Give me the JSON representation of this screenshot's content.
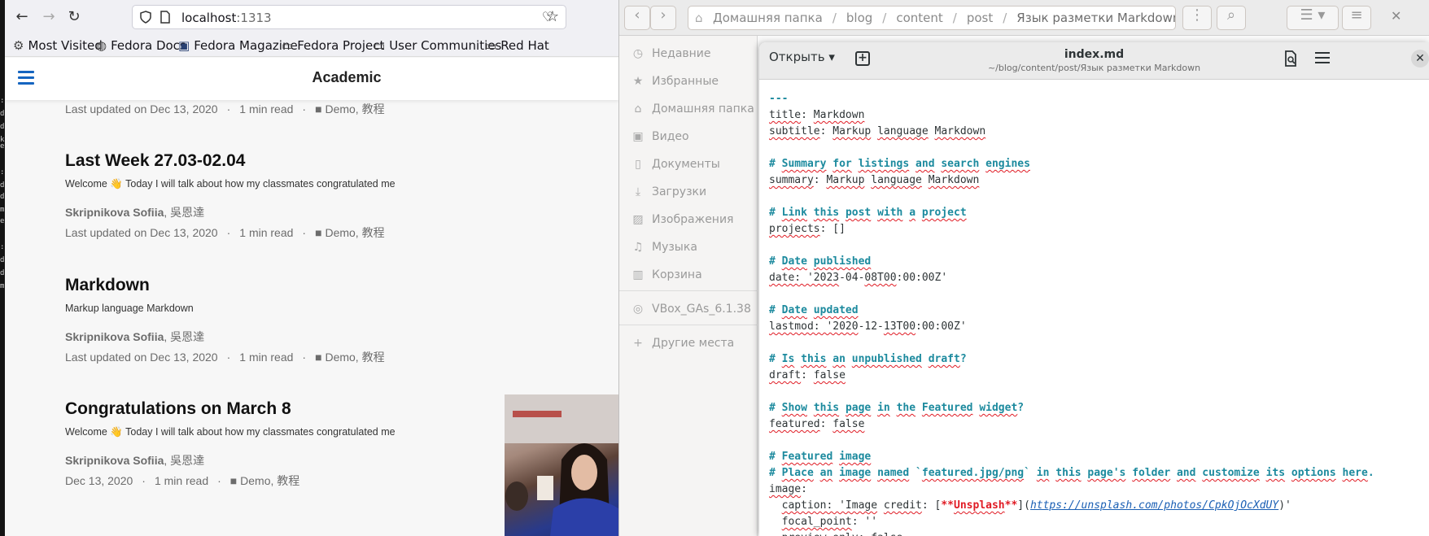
{
  "terminal": {
    "glyphs": [
      ":",
      "d",
      "d",
      "k",
      "e",
      ":",
      "d",
      "d",
      "m",
      "e",
      ":",
      "d",
      "d",
      "m"
    ]
  },
  "browser": {
    "url_host": "localhost",
    "url_port": ":1313",
    "bookmarks": [
      "Most Visited",
      "Fedora Docs",
      "Fedora Magazine",
      "Fedora Project",
      "User Communities",
      "Red Hat"
    ],
    "site_title": "Academic",
    "posts": [
      {
        "title": "",
        "summary": "",
        "authors_bold": "",
        "authors_rest": "",
        "updated": "Last updated on Dec 13, 2020",
        "read": "1 min read",
        "categories": "Demo, 教程"
      },
      {
        "title": "Last Week 27.03-02.04",
        "summary": "Welcome 👋 Today I will talk about how my classmates congratulated me",
        "authors_bold": "Skripnikova Sofiia",
        "authors_rest": ", 吳恩達",
        "updated": "Last updated on Dec 13, 2020",
        "read": "1 min read",
        "categories": "Demo, 教程"
      },
      {
        "title": "Markdown",
        "summary": "Markup language Markdown",
        "authors_bold": "Skripnikova Sofiia",
        "authors_rest": ", 吳恩達",
        "updated": "Last updated on Dec 13, 2020",
        "read": "1 min read",
        "categories": "Demo, 教程"
      },
      {
        "title": "Congratulations on March 8",
        "summary": "Welcome 👋 Today I will talk about how my classmates congratulated me",
        "authors_bold": "Skripnikova Sofiia",
        "authors_rest": ", 吳恩達",
        "updated": "Dec 13, 2020",
        "read": "1 min read",
        "categories": "Demo, 教程"
      }
    ]
  },
  "files": {
    "path": [
      "Домашняя папка",
      "blog",
      "content",
      "post",
      "Язык разметки Markdown"
    ],
    "sidebar": [
      {
        "label": "Недавние",
        "icon": "clock-icon"
      },
      {
        "label": "Избранные",
        "icon": "star-icon"
      },
      {
        "label": "Домашняя папка",
        "icon": "home-icon"
      },
      {
        "label": "Видео",
        "icon": "video-icon"
      },
      {
        "label": "Документы",
        "icon": "document-icon"
      },
      {
        "label": "Загрузки",
        "icon": "download-icon"
      },
      {
        "label": "Изображения",
        "icon": "image-icon"
      },
      {
        "label": "Музыка",
        "icon": "music-icon"
      },
      {
        "label": "Корзина",
        "icon": "trash-icon"
      },
      {
        "label": "VBox_GAs_6.1.38",
        "icon": "disc-icon"
      },
      {
        "label": "Другие места",
        "icon": "plus-icon"
      }
    ]
  },
  "editor": {
    "open_label": "Открыть",
    "filename": "index.md",
    "filepath": "~/blog/content/post/Язык разметки Markdown"
  }
}
